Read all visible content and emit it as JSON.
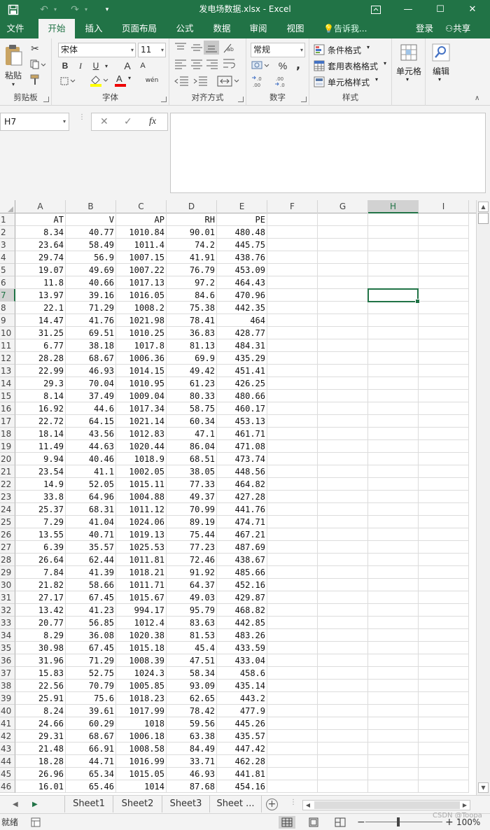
{
  "titlebar": {
    "title": "发电场数据.xlsx - Excel",
    "save_icon": "save-icon",
    "undo_icon": "undo-icon",
    "redo_icon": "redo-icon",
    "customize_icon": "chevron-down-icon",
    "ribbon_display_icon": "ribbon-display-icon",
    "minimize_glyph": "—",
    "maximize_glyph": "☐",
    "close_glyph": "✕"
  },
  "tabs": [
    {
      "label": "文件"
    },
    {
      "label": "开始"
    },
    {
      "label": "插入"
    },
    {
      "label": "页面布局"
    },
    {
      "label": "公式"
    },
    {
      "label": "数据"
    },
    {
      "label": "审阅"
    },
    {
      "label": "视图"
    }
  ],
  "active_tab": "开始",
  "tell_me": "告诉我...",
  "login": "登录",
  "share": "共享",
  "ribbon": {
    "clipboard": {
      "label": "剪贴板",
      "paste": "粘贴"
    },
    "font": {
      "label": "字体",
      "font_name": "宋体",
      "font_size": "11",
      "bold": "B",
      "italic": "I",
      "underline": "U",
      "grow": "A",
      "shrink": "A",
      "font_color_letter": "A",
      "phonetic": "wén"
    },
    "alignment": {
      "label": "对齐方式"
    },
    "number": {
      "label": "数字",
      "format": "常规",
      "percent": "%",
      "comma": ","
    },
    "styles": {
      "label": "样式",
      "conditional": "条件格式",
      "table": "套用表格格式",
      "cell_styles": "单元格样式"
    },
    "cells": {
      "label": "单元格"
    },
    "editing": {
      "label": "编辑"
    }
  },
  "formula_bar": {
    "name_box": "H7",
    "cancel": "✕",
    "enter": "✓",
    "fx": "fx",
    "formula": ""
  },
  "columns": [
    "A",
    "B",
    "C",
    "D",
    "E",
    "F",
    "G",
    "H",
    "I"
  ],
  "selected_column": "H",
  "selected_row": "7",
  "rows": [
    {
      "n": "1",
      "c": [
        "AT",
        "V",
        "AP",
        "RH",
        "PE"
      ]
    },
    {
      "n": "2",
      "c": [
        "8.34",
        "40.77",
        "1010.84",
        "90.01",
        "480.48"
      ]
    },
    {
      "n": "3",
      "c": [
        "23.64",
        "58.49",
        "1011.4",
        "74.2",
        "445.75"
      ]
    },
    {
      "n": "4",
      "c": [
        "29.74",
        "56.9",
        "1007.15",
        "41.91",
        "438.76"
      ]
    },
    {
      "n": "5",
      "c": [
        "19.07",
        "49.69",
        "1007.22",
        "76.79",
        "453.09"
      ]
    },
    {
      "n": "6",
      "c": [
        "11.8",
        "40.66",
        "1017.13",
        "97.2",
        "464.43"
      ]
    },
    {
      "n": "7",
      "c": [
        "13.97",
        "39.16",
        "1016.05",
        "84.6",
        "470.96"
      ]
    },
    {
      "n": "8",
      "c": [
        "22.1",
        "71.29",
        "1008.2",
        "75.38",
        "442.35"
      ]
    },
    {
      "n": "9",
      "c": [
        "14.47",
        "41.76",
        "1021.98",
        "78.41",
        "464"
      ]
    },
    {
      "n": "10",
      "c": [
        "31.25",
        "69.51",
        "1010.25",
        "36.83",
        "428.77"
      ]
    },
    {
      "n": "11",
      "c": [
        "6.77",
        "38.18",
        "1017.8",
        "81.13",
        "484.31"
      ]
    },
    {
      "n": "12",
      "c": [
        "28.28",
        "68.67",
        "1006.36",
        "69.9",
        "435.29"
      ]
    },
    {
      "n": "13",
      "c": [
        "22.99",
        "46.93",
        "1014.15",
        "49.42",
        "451.41"
      ]
    },
    {
      "n": "14",
      "c": [
        "29.3",
        "70.04",
        "1010.95",
        "61.23",
        "426.25"
      ]
    },
    {
      "n": "15",
      "c": [
        "8.14",
        "37.49",
        "1009.04",
        "80.33",
        "480.66"
      ]
    },
    {
      "n": "16",
      "c": [
        "16.92",
        "44.6",
        "1017.34",
        "58.75",
        "460.17"
      ]
    },
    {
      "n": "17",
      "c": [
        "22.72",
        "64.15",
        "1021.14",
        "60.34",
        "453.13"
      ]
    },
    {
      "n": "18",
      "c": [
        "18.14",
        "43.56",
        "1012.83",
        "47.1",
        "461.71"
      ]
    },
    {
      "n": "19",
      "c": [
        "11.49",
        "44.63",
        "1020.44",
        "86.04",
        "471.08"
      ]
    },
    {
      "n": "20",
      "c": [
        "9.94",
        "40.46",
        "1018.9",
        "68.51",
        "473.74"
      ]
    },
    {
      "n": "21",
      "c": [
        "23.54",
        "41.1",
        "1002.05",
        "38.05",
        "448.56"
      ]
    },
    {
      "n": "22",
      "c": [
        "14.9",
        "52.05",
        "1015.11",
        "77.33",
        "464.82"
      ]
    },
    {
      "n": "23",
      "c": [
        "33.8",
        "64.96",
        "1004.88",
        "49.37",
        "427.28"
      ]
    },
    {
      "n": "24",
      "c": [
        "25.37",
        "68.31",
        "1011.12",
        "70.99",
        "441.76"
      ]
    },
    {
      "n": "25",
      "c": [
        "7.29",
        "41.04",
        "1024.06",
        "89.19",
        "474.71"
      ]
    },
    {
      "n": "26",
      "c": [
        "13.55",
        "40.71",
        "1019.13",
        "75.44",
        "467.21"
      ]
    },
    {
      "n": "27",
      "c": [
        "6.39",
        "35.57",
        "1025.53",
        "77.23",
        "487.69"
      ]
    },
    {
      "n": "28",
      "c": [
        "26.64",
        "62.44",
        "1011.81",
        "72.46",
        "438.67"
      ]
    },
    {
      "n": "29",
      "c": [
        "7.84",
        "41.39",
        "1018.21",
        "91.92",
        "485.66"
      ]
    },
    {
      "n": "30",
      "c": [
        "21.82",
        "58.66",
        "1011.71",
        "64.37",
        "452.16"
      ]
    },
    {
      "n": "31",
      "c": [
        "27.17",
        "67.45",
        "1015.67",
        "49.03",
        "429.87"
      ]
    },
    {
      "n": "32",
      "c": [
        "13.42",
        "41.23",
        "994.17",
        "95.79",
        "468.82"
      ]
    },
    {
      "n": "33",
      "c": [
        "20.77",
        "56.85",
        "1012.4",
        "83.63",
        "442.85"
      ]
    },
    {
      "n": "34",
      "c": [
        "8.29",
        "36.08",
        "1020.38",
        "81.53",
        "483.26"
      ]
    },
    {
      "n": "35",
      "c": [
        "30.98",
        "67.45",
        "1015.18",
        "45.4",
        "433.59"
      ]
    },
    {
      "n": "36",
      "c": [
        "31.96",
        "71.29",
        "1008.39",
        "47.51",
        "433.04"
      ]
    },
    {
      "n": "37",
      "c": [
        "15.83",
        "52.75",
        "1024.3",
        "58.34",
        "458.6"
      ]
    },
    {
      "n": "38",
      "c": [
        "22.56",
        "70.79",
        "1005.85",
        "93.09",
        "435.14"
      ]
    },
    {
      "n": "39",
      "c": [
        "25.91",
        "75.6",
        "1018.23",
        "62.65",
        "443.2"
      ]
    },
    {
      "n": "40",
      "c": [
        "8.24",
        "39.61",
        "1017.99",
        "78.42",
        "477.9"
      ]
    },
    {
      "n": "41",
      "c": [
        "24.66",
        "60.29",
        "1018",
        "59.56",
        "445.26"
      ]
    },
    {
      "n": "42",
      "c": [
        "29.31",
        "68.67",
        "1006.18",
        "63.38",
        "435.57"
      ]
    },
    {
      "n": "43",
      "c": [
        "21.48",
        "66.91",
        "1008.58",
        "84.49",
        "447.42"
      ]
    },
    {
      "n": "44",
      "c": [
        "18.28",
        "44.71",
        "1016.99",
        "33.71",
        "462.28"
      ]
    },
    {
      "n": "45",
      "c": [
        "26.96",
        "65.34",
        "1015.05",
        "46.93",
        "441.81"
      ]
    },
    {
      "n": "46",
      "c": [
        "16.01",
        "65.46",
        "1014",
        "87.68",
        "454.16"
      ]
    }
  ],
  "sheets": [
    {
      "label": "Sheet1"
    },
    {
      "label": "Sheet2"
    },
    {
      "label": "Sheet3"
    },
    {
      "label": "Sheet ..."
    }
  ],
  "status": {
    "ready": "就绪",
    "zoom": "100%",
    "watermark": "CSDN @Toopa"
  },
  "colors": {
    "excel_green": "#217346",
    "ribbon_bg": "#f3f3f3"
  }
}
